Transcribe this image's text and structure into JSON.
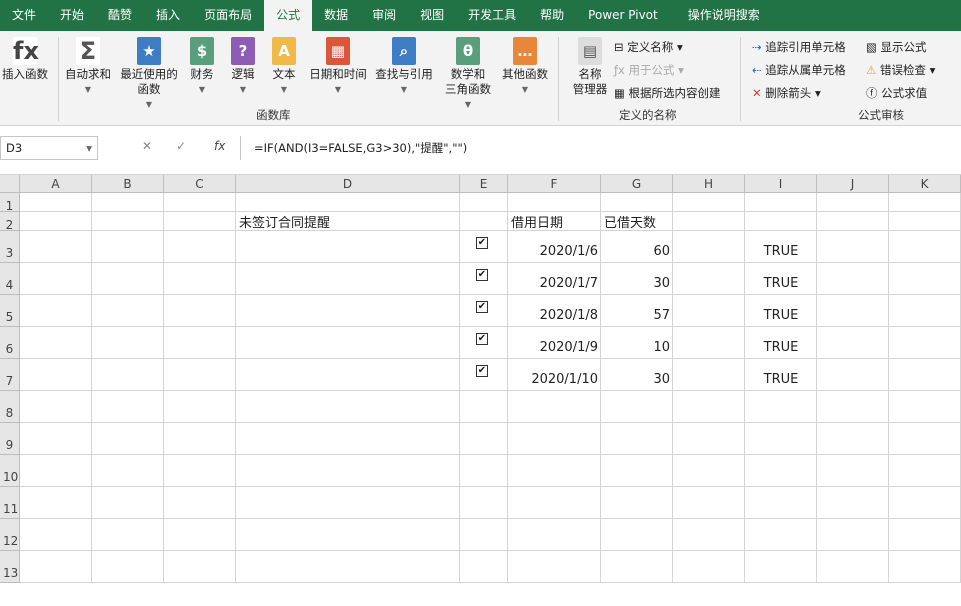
{
  "tabs": [
    "文件",
    "开始",
    "酷赞",
    "插入",
    "页面布局",
    "公式",
    "数据",
    "审阅",
    "视图",
    "开发工具",
    "帮助",
    "Power Pivot",
    "操作说明搜索"
  ],
  "ribbon": {
    "function_library": {
      "label": "函数库",
      "buttons": [
        "插入函数",
        "自动求和",
        "最近使用的\n函数",
        "财务",
        "逻辑",
        "文本",
        "日期和时间",
        "查找与引用",
        "数学和\n三角函数",
        "其他函数"
      ]
    },
    "defined_names": {
      "label": "定义的名称",
      "manager": "名称\n管理器",
      "define_name": "定义名称",
      "use_in_formula": "用于公式",
      "create_from_selection": "根据所选内容创建"
    },
    "formula_auditing": {
      "label": "公式审核",
      "trace_precedents": "追踪引用单元格",
      "trace_dependents": "追踪从属单元格",
      "remove_arrows": "删除箭头",
      "show_formulas": "显示公式",
      "error_checking": "错误检查",
      "evaluate_formula": "公式求值"
    }
  },
  "formula_bar": {
    "name_box": "D3",
    "formula": "=IF(AND(I3=FALSE,G3>30),\"提醒\",\"\")"
  },
  "columns": [
    "A",
    "B",
    "C",
    "D",
    "E",
    "F",
    "G",
    "H",
    "I",
    "J",
    "K"
  ],
  "rows": [
    "1",
    "2",
    "3",
    "4",
    "5",
    "6",
    "7",
    "8",
    "9",
    "10",
    "11",
    "12",
    "13"
  ],
  "cells": {
    "D2": "未签订合同提醒",
    "F2": "借用日期",
    "G2": "已借天数"
  },
  "data_rows": [
    {
      "date": "2020/1/6",
      "days": "60",
      "flag": "TRUE",
      "checked": true
    },
    {
      "date": "2020/1/7",
      "days": "30",
      "flag": "TRUE",
      "checked": true
    },
    {
      "date": "2020/1/8",
      "days": "57",
      "flag": "TRUE",
      "checked": true
    },
    {
      "date": "2020/1/9",
      "days": "10",
      "flag": "TRUE",
      "checked": true
    },
    {
      "date": "2020/1/10",
      "days": "30",
      "flag": "TRUE",
      "checked": true
    }
  ],
  "colors": {
    "brand": "#217346"
  }
}
